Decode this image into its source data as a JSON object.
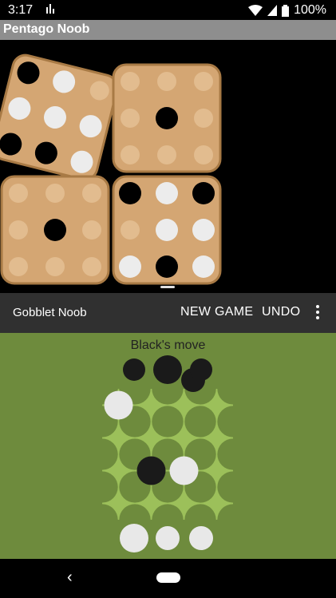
{
  "status_bar": {
    "time": "3:17",
    "battery_text": "100%",
    "icons": [
      "notification-bars-icon",
      "wifi-icon",
      "signal-icon",
      "battery-icon"
    ]
  },
  "window": {
    "title": "Pentago Noob"
  },
  "pentago": {
    "colors": {
      "tile": "#d4a673",
      "tile_border": "#a87a45",
      "empty": "#e2bc8f",
      "black": "#000000",
      "white": "#ececec"
    },
    "quadrants": [
      {
        "name": "top-left",
        "rotated": true,
        "cells": [
          "B",
          "W",
          "E",
          "W",
          "W",
          "W",
          "B",
          "B",
          "W"
        ]
      },
      {
        "name": "top-right",
        "rotated": false,
        "cells": [
          "E",
          "E",
          "E",
          "E",
          "B",
          "E",
          "E",
          "E",
          "E"
        ]
      },
      {
        "name": "bottom-left",
        "rotated": false,
        "cells": [
          "E",
          "E",
          "E",
          "E",
          "B",
          "E",
          "E",
          "E",
          "E"
        ]
      },
      {
        "name": "bottom-right",
        "rotated": false,
        "cells": [
          "B",
          "W",
          "B",
          "E",
          "W",
          "W",
          "W",
          "B",
          "W"
        ]
      }
    ]
  },
  "gobblet_app": {
    "title": "Gobblet Noob",
    "new_game_label": "NEW GAME",
    "undo_label": "UNDO",
    "menu_icon": "more-vert-icon"
  },
  "gobblet": {
    "status": "Black's move",
    "colors": {
      "background": "#6e8b3d",
      "board_light": "#9cc05a",
      "board_dark": "#6e8b3d",
      "black": "#1a1a1a",
      "white": "#e8e8e8"
    },
    "black_reserve": [
      "small",
      "large",
      "medium"
    ],
    "white_reserve": [
      "large",
      "medium",
      "medium"
    ],
    "board_pieces": [
      {
        "row": 0,
        "col": 0,
        "color": "white",
        "size": "large"
      },
      {
        "row": 2,
        "col": 1,
        "color": "black",
        "size": "large"
      },
      {
        "row": 2,
        "col": 2,
        "color": "white",
        "size": "large"
      }
    ]
  },
  "nav_bar": {
    "back_icon": "back-icon",
    "home_icon": "home-pill-icon"
  }
}
